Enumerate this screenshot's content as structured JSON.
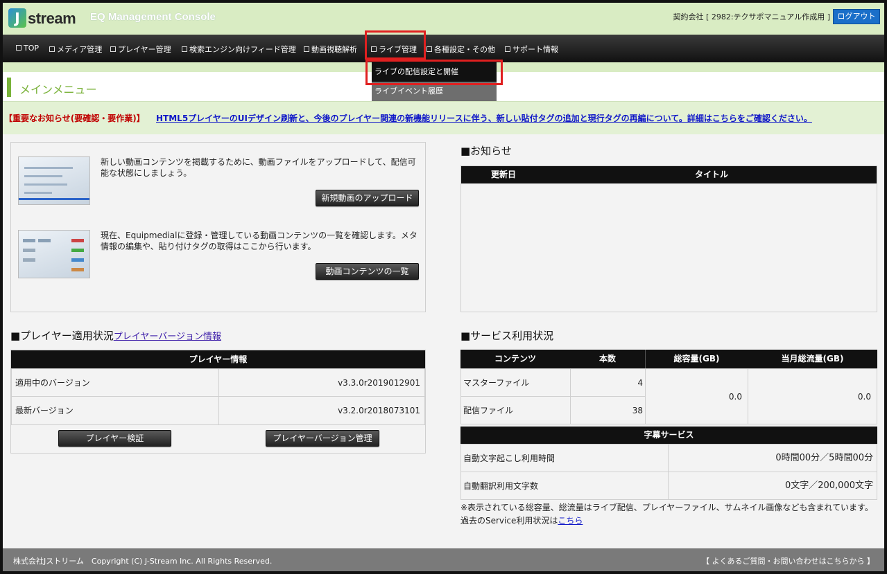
{
  "header": {
    "logo_text": "stream",
    "logo_letter": "J",
    "app_title": "EQ Management Console",
    "contract": "契約会社 [ 2982:テクサポマニュアル作成用 ]",
    "logout": "ログアウト"
  },
  "nav": {
    "items": [
      "TOP",
      "メディア管理",
      "プレイヤー管理",
      "検索エンジン向けフィード管理",
      "動画視聴解析",
      "ライブ管理",
      "各種設定・その他",
      "サポート情報"
    ],
    "dropdown": [
      "ライブの配信設定と開催",
      "ライブイベント履歴"
    ]
  },
  "main_menu": {
    "title": "メインメニュー"
  },
  "notice": {
    "label": "【重要なお知らせ(要確認・要作業)】",
    "link": "HTML5プレイヤーのUIデザイン刷新と、今後のプレイヤー関連の新機能リリースに伴う、新しい貼付タグの追加と現行タグの再編について。詳細はこちらをご確認ください。"
  },
  "quick": {
    "upload_desc": "新しい動画コンテンツを掲載するために、動画ファイルをアップロードして、配信可能な状態にしましょう。",
    "upload_button": "新規動画のアップロード",
    "list_desc": "現在、Equipmedialに登録・管理している動画コンテンツの一覧を確認します。メタ情報の編集や、貼り付けタグの取得はここから行います。",
    "list_button": "動画コンテンツの一覧"
  },
  "news": {
    "title": "■お知らせ",
    "col_date": "更新日",
    "col_title": "タイトル"
  },
  "player": {
    "title": "■プレイヤー適用状況",
    "link": "プレイヤーバージョン情報",
    "table_head": "プレイヤー情報",
    "rows": [
      {
        "label": "適用中のバージョン",
        "value": "v3.3.0r2019012901"
      },
      {
        "label": "最新バージョン",
        "value": "v3.2.0r2018073101"
      }
    ],
    "verify_button": "プレイヤー検証",
    "manage_button": "プレイヤーバージョン管理"
  },
  "service": {
    "title": "■サービス利用状況",
    "headers": [
      "コンテンツ",
      "本数",
      "総容量(GB)",
      "当月総流量(GB)"
    ],
    "rows": [
      {
        "label": "マスターファイル",
        "count": "4"
      },
      {
        "label": "配信ファイル",
        "count": "38"
      }
    ],
    "total_size": "0.0",
    "monthly_traffic": "0.0",
    "subtitle_head": "字幕サービス",
    "subtitle_rows": [
      {
        "label": "自動文字起こし利用時間",
        "value": "0時間00分／5時間00分"
      },
      {
        "label": "自動翻訳利用文字数",
        "value": "0文字／200,000文字"
      }
    ],
    "note": "※表示されている総容量、総流量はライブ配信、プレイヤーファイル、サムネイル画像なども含まれています。",
    "past_text": "過去のService利用状況は",
    "past_link": "こちら"
  },
  "footer": {
    "copyright": "株式会社Jストリーム　Copyright (C) J-Stream Inc. All Rights Reserved.",
    "faq": "【 よくあるご質問・お問い合わせはこちらから 】"
  },
  "colors": {
    "accent_green": "#79b33a",
    "highlight_red": "#e02020",
    "notice_red": "#c00000",
    "link_blue": "#1018c8",
    "logout_blue": "#1a6fc9"
  }
}
